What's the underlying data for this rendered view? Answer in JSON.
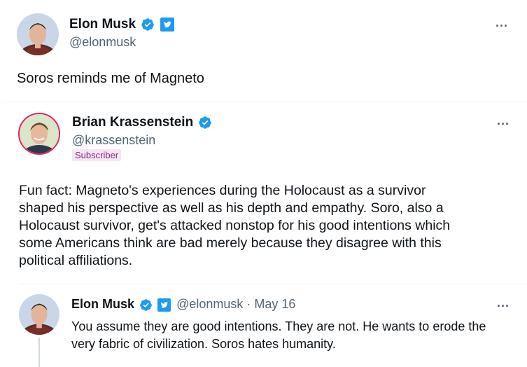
{
  "tweet1": {
    "name": "Elon Musk",
    "handle": "@elonmusk",
    "text": "Soros reminds me of Magneto",
    "more": "..."
  },
  "tweet2": {
    "name": "Brian Krassenstein",
    "handle": "@krassenstein",
    "badge": "Subscriber",
    "lines": [
      "Fun fact:  Magneto's experiences during the Holocaust as a survivor",
      "shaped his perspective as well as his depth and empathy.  Soro, also a",
      "Holocaust survivor, get's attacked nonstop for his good intentions which",
      "some Americans think are bad merely because they disagree with this",
      "political affiliations."
    ],
    "more": "..."
  },
  "tweet3": {
    "name": "Elon Musk",
    "handle": "@elonmusk",
    "date": "· May 16",
    "lines": [
      "You assume they are good intentions. They are not. He wants to erode the",
      "very fabric of civilization. Soros hates humanity."
    ],
    "more": "..."
  },
  "colors": {
    "verified": "#1d9bf0",
    "gov_badge": "#1d9bf0",
    "badge_bg": "#f5e6f3"
  },
  "icons": [
    "verified-badge-icon",
    "twitter-bird-badge-icon",
    "more-options-icon"
  ]
}
